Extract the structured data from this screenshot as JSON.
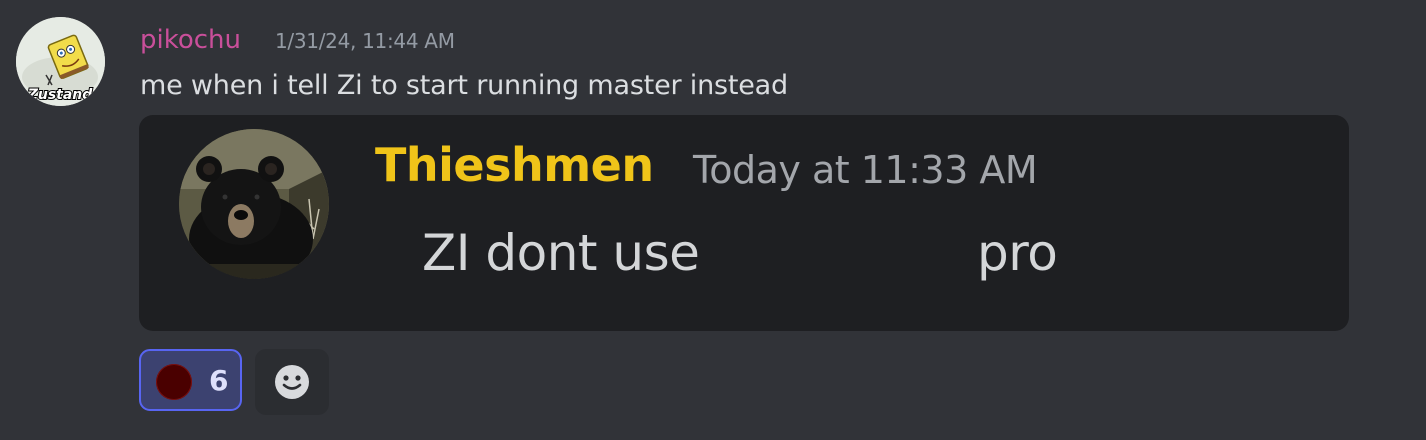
{
  "message": {
    "author": "pikochu",
    "timestamp": "1/31/24, 11:44 AM",
    "text": "me when i tell Zi to start running master instead",
    "author_color": "#c94f9a"
  },
  "embed": {
    "author": "Thieshmen",
    "timestamp": "Today at 11:33 AM",
    "text_left": "ZI dont use",
    "text_right": "pro",
    "author_color": "#f0c419"
  },
  "reactions": {
    "emoji_icon": "red-circle-icon",
    "count": "6"
  },
  "add_reaction": {
    "icon": "add-reaction-smiley-icon"
  },
  "avatar": {
    "icon": "sponge-avatar",
    "caption": "Zustand"
  },
  "embed_avatar": {
    "icon": "black-bear-avatar"
  }
}
